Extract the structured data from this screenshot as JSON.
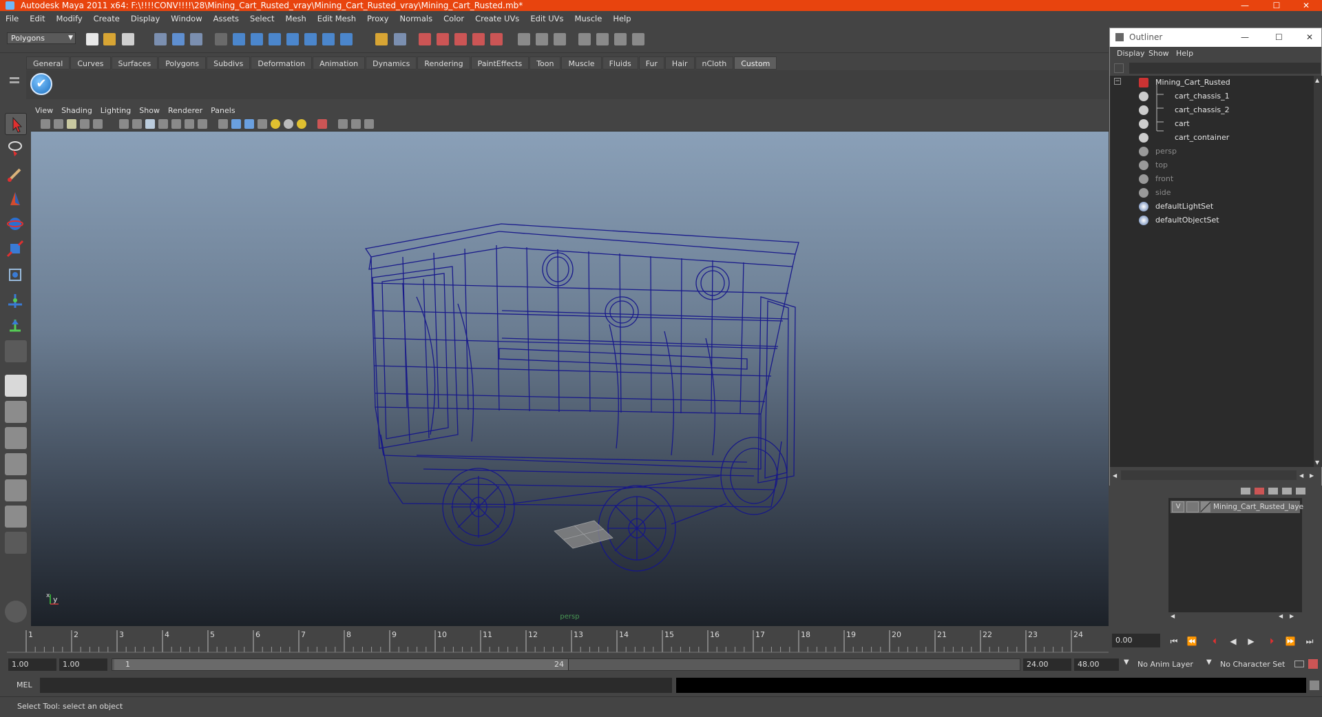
{
  "window": {
    "title": "Autodesk Maya 2011 x64: F:\\!!!!CONV!!!!\\28\\Mining_Cart_Rusted_vray\\Mining_Cart_Rusted_vray\\Mining_Cart_Rusted.mb*",
    "minimize": "—",
    "maximize": "☐",
    "close": "✕"
  },
  "menubar": [
    "File",
    "Edit",
    "Modify",
    "Create",
    "Display",
    "Window",
    "Assets",
    "Select",
    "Mesh",
    "Edit Mesh",
    "Proxy",
    "Normals",
    "Color",
    "Create UVs",
    "Edit UVs",
    "Muscle",
    "Help"
  ],
  "statusline": {
    "mode": "Polygons"
  },
  "shelf": {
    "tabs": [
      "General",
      "Curves",
      "Surfaces",
      "Polygons",
      "Subdivs",
      "Deformation",
      "Animation",
      "Dynamics",
      "Rendering",
      "PaintEffects",
      "Toon",
      "Muscle",
      "Fluids",
      "Fur",
      "Hair",
      "nCloth",
      "Custom"
    ],
    "active_tab": "Custom"
  },
  "viewport": {
    "menu": [
      "View",
      "Shading",
      "Lighting",
      "Show",
      "Renderer",
      "Panels"
    ],
    "camera": "persp",
    "axis_y": "y",
    "axis_x": "x"
  },
  "timeline": {
    "ticks": [
      "1",
      "2",
      "3",
      "4",
      "5",
      "6",
      "7",
      "8",
      "9",
      "10",
      "11",
      "12",
      "13",
      "14",
      "15",
      "16",
      "17",
      "18",
      "19",
      "20",
      "21",
      "22",
      "23",
      "24"
    ],
    "current_frame": "0.00"
  },
  "range": {
    "start_time": "1.00",
    "playback_start": "1.00",
    "range_start": "1",
    "range_end": "24",
    "playback_end": "24.00",
    "end_time": "48.00",
    "anim_layer": "No Anim Layer",
    "character_set": "No Character Set"
  },
  "cmdline": {
    "label": "MEL"
  },
  "helpline": {
    "text": "Select Tool: select an object"
  },
  "outliner": {
    "title": "Outliner",
    "menu": [
      "Display",
      "Show",
      "Help"
    ],
    "items": [
      {
        "label": "Mining_Cart_Rusted",
        "type": "group",
        "dim": false
      },
      {
        "label": "cart_chassis_1",
        "type": "mesh",
        "dim": false
      },
      {
        "label": "cart_chassis_2",
        "type": "mesh",
        "dim": false
      },
      {
        "label": "cart",
        "type": "mesh",
        "dim": false
      },
      {
        "label": "cart_container",
        "type": "mesh",
        "dim": false
      },
      {
        "label": "persp",
        "type": "camera",
        "dim": true
      },
      {
        "label": "top",
        "type": "camera",
        "dim": true
      },
      {
        "label": "front",
        "type": "camera",
        "dim": true
      },
      {
        "label": "side",
        "type": "camera",
        "dim": true
      },
      {
        "label": "defaultLightSet",
        "type": "set",
        "dim": false
      },
      {
        "label": "defaultObjectSet",
        "type": "set",
        "dim": false
      }
    ]
  },
  "layers": {
    "items": [
      {
        "visible": "V",
        "name": "Mining_Cart_Rusted_laye"
      }
    ]
  },
  "colors": {
    "titlebar": "#e8440e",
    "wireframe": "#1a1a8c",
    "panel": "#444444",
    "field": "#2b2b2b"
  }
}
